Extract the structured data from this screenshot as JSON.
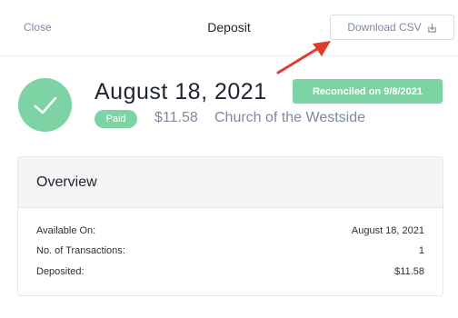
{
  "header": {
    "close_label": "Close",
    "title": "Deposit",
    "download_label": "Download CSV"
  },
  "summary": {
    "date": "August 18, 2021",
    "reconciled_label": "Reconciled on 9/8/2021",
    "status_badge": "Paid",
    "amount": "$11.58",
    "organization": "Church of the Westside"
  },
  "overview": {
    "title": "Overview",
    "rows": [
      {
        "label": "Available On:",
        "value": "August 18, 2021"
      },
      {
        "label": "No. of Transactions:",
        "value": "1"
      },
      {
        "label": "Deposited:",
        "value": "$11.58"
      }
    ]
  },
  "colors": {
    "accent_green": "#7ed3a4",
    "muted_text": "#7d8aa3",
    "annotation_arrow": "#e03c2b"
  },
  "icons": [
    "check-icon",
    "download-icon",
    "annotation-arrow"
  ]
}
